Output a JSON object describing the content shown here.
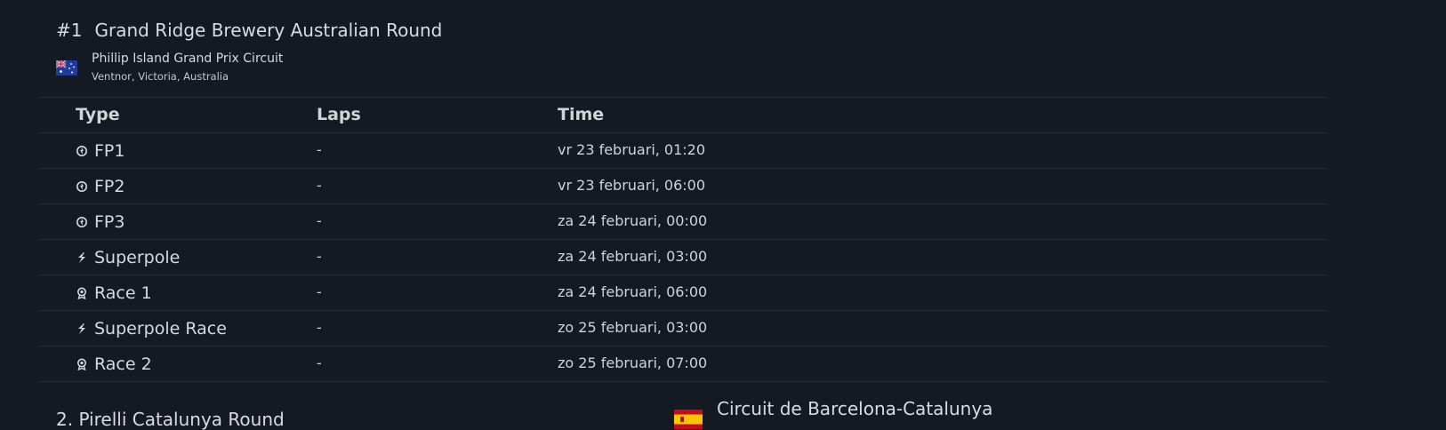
{
  "round": {
    "number": "#1",
    "name": "Grand Ridge Brewery Australian Round",
    "circuit_name": "Phillip Island Grand Prix Circuit",
    "circuit_location": "Ventnor, Victoria, Australia",
    "flag_icon": "australia-flag-icon"
  },
  "table": {
    "headers": {
      "type": "Type",
      "laps": "Laps",
      "time": "Time"
    },
    "rows": [
      {
        "icon": "practice-icon",
        "type": "FP1",
        "laps": "-",
        "time": "vr 23 februari, 01:20"
      },
      {
        "icon": "practice-icon",
        "type": "FP2",
        "laps": "-",
        "time": "vr 23 februari, 06:00"
      },
      {
        "icon": "practice-icon",
        "type": "FP3",
        "laps": "-",
        "time": "za 24 februari, 00:00"
      },
      {
        "icon": "superpole-icon",
        "type": "Superpole",
        "laps": "-",
        "time": "za 24 februari, 03:00"
      },
      {
        "icon": "race-icon",
        "type": "Race 1",
        "laps": "-",
        "time": "za 24 februari, 06:00"
      },
      {
        "icon": "superpole-icon",
        "type": "Superpole Race",
        "laps": "-",
        "time": "zo 25 februari, 03:00"
      },
      {
        "icon": "race-icon",
        "type": "Race 2",
        "laps": "-",
        "time": "zo 25 februari, 07:00"
      }
    ]
  },
  "next_round": {
    "title": "2. Pirelli Catalunya Round",
    "circuit_name": "Circuit de Barcelona-Catalunya",
    "flag_icon": "spain-flag-icon"
  },
  "colors": {
    "background": "#151922",
    "divider": "#272c36",
    "text": "#d6d9de"
  }
}
